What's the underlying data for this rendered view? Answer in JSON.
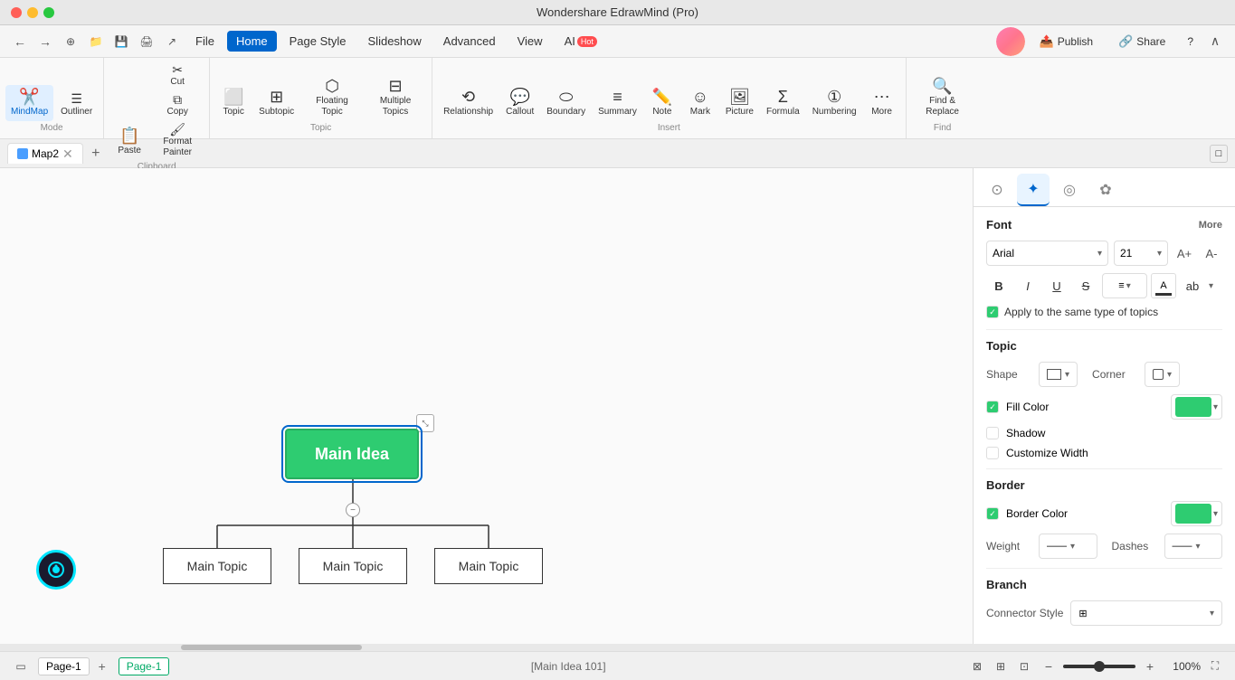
{
  "app": {
    "title": "Wondershare EdrawMind (Pro)"
  },
  "menubar": {
    "nav_back": "←",
    "nav_forward": "→",
    "menus": [
      "File",
      "Home",
      "Page Style",
      "Slideshow",
      "Advanced",
      "View",
      "AI"
    ],
    "active_menu": "Home",
    "publish_label": "Publish",
    "share_label": "Share",
    "help_label": "?",
    "ai_badge": "Hot",
    "expand_btn": "∧"
  },
  "ribbon": {
    "mode_section_label": "Mode",
    "clipboard_section_label": "Clipboard",
    "topic_section_label": "Topic",
    "insert_section_label": "Insert",
    "find_section_label": "Find",
    "mindmap_label": "MindMap",
    "outliner_label": "Outliner",
    "paste_label": "Paste",
    "cut_label": "Cut",
    "copy_label": "Copy",
    "format_painter_label": "Format\nPainter",
    "topic_label": "Topic",
    "subtopic_label": "Subtopic",
    "floating_topic_label": "Floating\nTopic",
    "multiple_topics_label": "Multiple\nTopics",
    "relationship_label": "Relationship",
    "callout_label": "Callout",
    "boundary_label": "Boundary",
    "summary_label": "Summary",
    "note_label": "Note",
    "mark_label": "Mark",
    "picture_label": "Picture",
    "formula_label": "Formula",
    "numbering_label": "Numbering",
    "more_label": "More",
    "find_replace_label": "Find &\nReplace"
  },
  "tabs": {
    "tab1": {
      "name": "Map2",
      "icon_color": "#4a9eff"
    },
    "add_label": "+",
    "fullscreen_label": "□"
  },
  "canvas": {
    "main_idea_text": "Main Idea",
    "topic1_text": "Main Topic",
    "topic2_text": "Main Topic",
    "topic3_text": "Main Topic"
  },
  "right_panel": {
    "tabs": [
      {
        "icon": "⊙",
        "name": "style-tab",
        "active": false
      },
      {
        "icon": "✦",
        "name": "ai-tab",
        "active": true
      },
      {
        "icon": "◎",
        "name": "location-tab",
        "active": false
      },
      {
        "icon": "✿",
        "name": "settings-tab",
        "active": false
      }
    ],
    "font_section": {
      "title": "Font",
      "more_label": "More",
      "font_name": "Arial",
      "font_size": "21",
      "increase_label": "A+",
      "decrease_label": "A-",
      "bold_label": "B",
      "italic_label": "I",
      "underline_label": "U",
      "strikethrough_label": "S",
      "align_label": "≡",
      "font_color_label": "A",
      "highlight_label": "ab"
    },
    "apply_same_label": "Apply to the same type of topics",
    "topic_section": {
      "title": "Topic",
      "shape_label": "Shape",
      "corner_label": "Corner",
      "fill_color_label": "Fill Color",
      "fill_color": "#2ecc71",
      "shadow_label": "Shadow",
      "customize_width_label": "Customize Width"
    },
    "border_section": {
      "title": "Border",
      "border_color_label": "Border Color",
      "border_color": "#2ecc71",
      "weight_label": "Weight",
      "dashes_label": "Dashes"
    },
    "branch_section": {
      "title": "Branch",
      "connector_style_label": "Connector Style"
    }
  },
  "statusbar": {
    "panel_icon": "▭",
    "page_name": "Page-1",
    "active_page": "Page-1",
    "add_page_label": "+",
    "status_info": "[Main Idea 101]",
    "zoom_minus": "−",
    "zoom_plus": "+",
    "zoom_level": "100%",
    "fullscreen_label": "⛶"
  }
}
